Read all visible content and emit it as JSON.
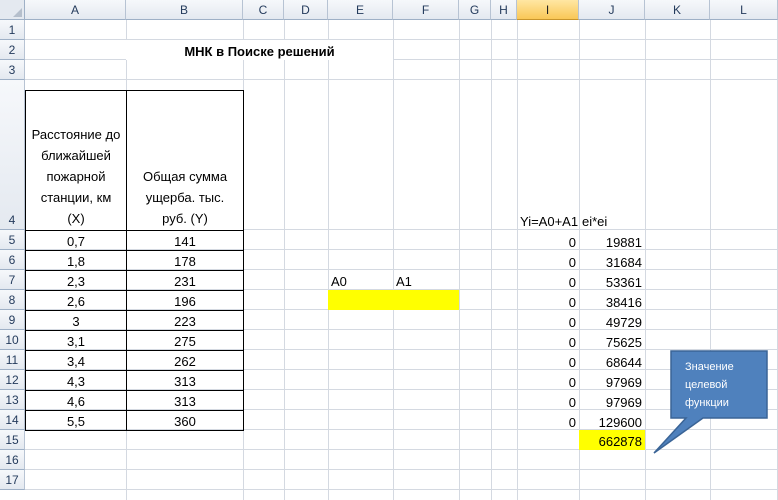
{
  "columns": [
    "A",
    "B",
    "C",
    "D",
    "E",
    "F",
    "G",
    "H",
    "I",
    "J",
    "K",
    "L"
  ],
  "selected_column": "I",
  "rows": [
    "1",
    "2",
    "3",
    "4",
    "5",
    "6",
    "7",
    "8",
    "9",
    "10",
    "11",
    "12",
    "13",
    "14",
    "15",
    "16",
    "17"
  ],
  "title": "МНК в Поиске решений",
  "table": {
    "header_x": "Расстояние до ближайшей пожарной станции, км (X)",
    "header_x_lines": [
      "Расстояние до",
      "ближайшей",
      "пожарной",
      "станции, км",
      "(X)"
    ],
    "header_y_lines": [
      "Общая сумма",
      "ущерба. тыс.",
      "руб. (Y)"
    ],
    "x": [
      "0,7",
      "1,8",
      "2,3",
      "2,6",
      "3",
      "3,1",
      "3,4",
      "4,3",
      "4,6",
      "5,5"
    ],
    "y": [
      "141",
      "178",
      "231",
      "196",
      "223",
      "275",
      "262",
      "313",
      "313",
      "360"
    ]
  },
  "params": {
    "a0_label": "A0",
    "a1_label": "A1"
  },
  "calc": {
    "yi_header": "Yi=A0+A1",
    "ei_header": "ei*ei",
    "yi": [
      "0",
      "0",
      "0",
      "0",
      "0",
      "0",
      "0",
      "0",
      "0",
      "0"
    ],
    "ei2": [
      "19881",
      "31684",
      "53361",
      "38416",
      "49729",
      "75625",
      "68644",
      "97969",
      "97969",
      "129600"
    ],
    "total": "662878"
  },
  "callout": {
    "lines": [
      "Значение",
      "целевой",
      "функции"
    ]
  },
  "colors": {
    "highlight": "#ffff00",
    "callout_fill": "#4f81bd",
    "callout_border": "#3a6496",
    "grid": "#d4d9e1"
  }
}
